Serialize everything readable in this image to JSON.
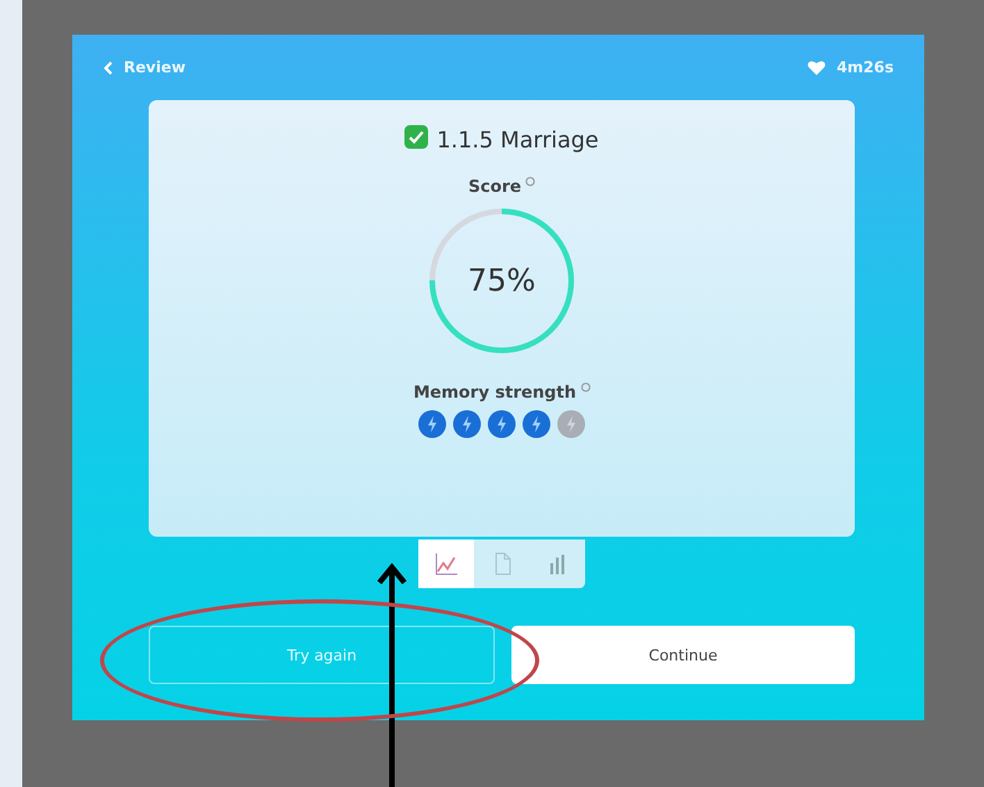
{
  "header": {
    "back_label": "Review",
    "time": "4m26s"
  },
  "result": {
    "title": "1.1.5 Marriage",
    "completed": true,
    "score_label": "Score",
    "score": {
      "reading": "75%"
    },
    "memory_label": "Memory strength",
    "memory": [
      {
        "filled": true
      },
      {
        "filled": true
      },
      {
        "filled": true
      },
      {
        "filled": true
      },
      {
        "filled": false
      }
    ]
  },
  "view_tabs": [
    {
      "kind": "chart",
      "selected": true
    },
    {
      "kind": "document",
      "selected": false
    },
    {
      "kind": "bars",
      "selected": false
    }
  ],
  "buttons": [
    {
      "label": "Try again",
      "kind": "outline",
      "circled": true
    },
    {
      "label": "Continue",
      "kind": "solid",
      "circled": false
    }
  ],
  "annotations": {
    "arrow": true
  }
}
